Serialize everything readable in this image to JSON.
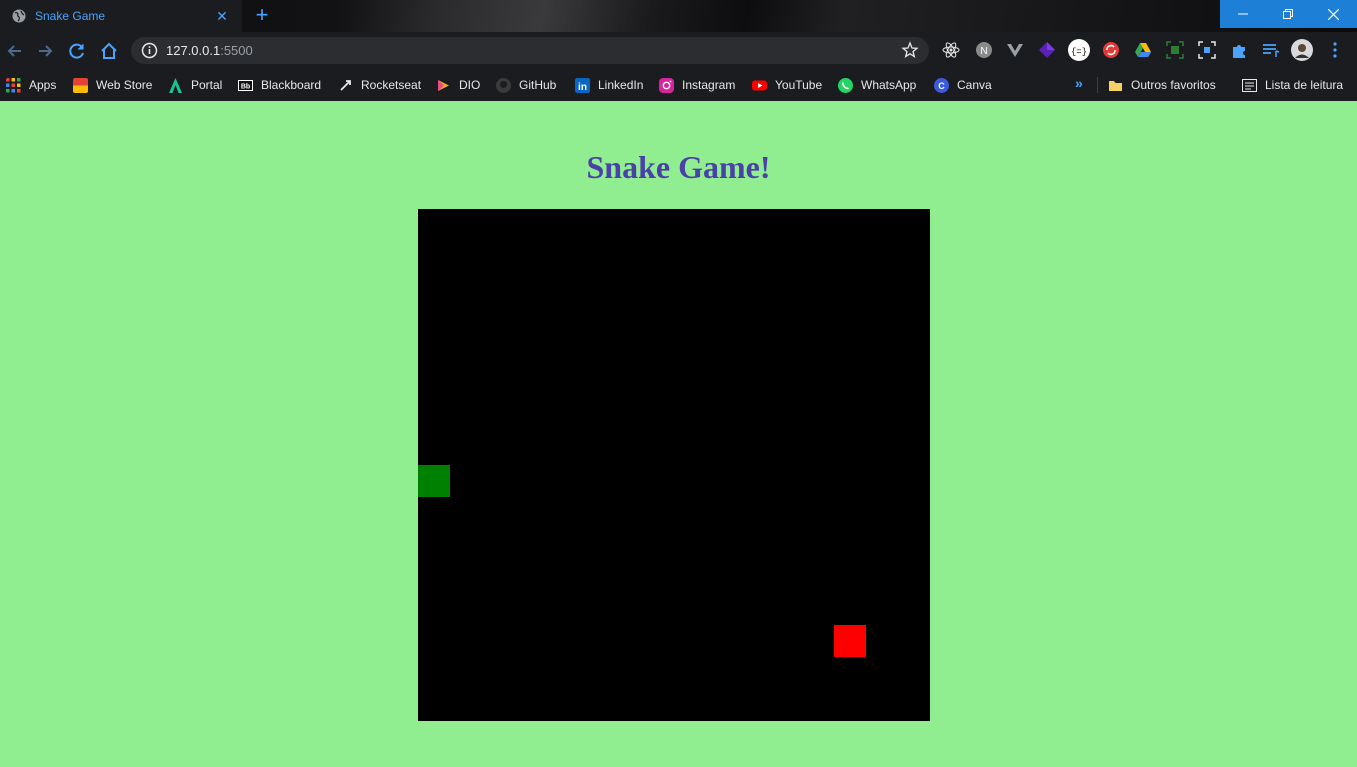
{
  "browser": {
    "tab_title": "Snake Game",
    "tab_close": "✕",
    "new_tab": "+",
    "url_host": "127.0.0.1",
    "url_port": ":5500",
    "bookmarks": [
      {
        "label": "Apps",
        "color": "#e8e8e8"
      },
      {
        "label": "Web Store",
        "color": "#e34234"
      },
      {
        "label": "Portal",
        "color": "#1ec28b"
      },
      {
        "label": "Blackboard",
        "color": "#ffffff"
      },
      {
        "label": "Rocketseat",
        "color": "#8257e5"
      },
      {
        "label": "DIO",
        "color": "#f5a623"
      },
      {
        "label": "GitHub",
        "color": "#6e6e6e"
      },
      {
        "label": "LinkedIn",
        "color": "#0a66c2"
      },
      {
        "label": "Instagram",
        "color": "#d6249f"
      },
      {
        "label": "YouTube",
        "color": "#ff0000"
      },
      {
        "label": "WhatsApp",
        "color": "#25d366"
      },
      {
        "label": "Canva",
        "color": "#3b5bdb"
      }
    ],
    "other_bookmarks": "Outros favoritos",
    "reading_list": "Lista de leitura",
    "accent_color": "#4aa3ff"
  },
  "page": {
    "title": "Snake Game!",
    "title_color": "#4b40a8",
    "background_color": "#90ee90"
  },
  "game": {
    "grid_size": 16,
    "board_color": "#000000",
    "snake": [
      {
        "col": 0,
        "row": 8
      }
    ],
    "snake_color": "#008000",
    "food": {
      "col": 13,
      "row": 13
    },
    "food_color": "#ff0000"
  }
}
